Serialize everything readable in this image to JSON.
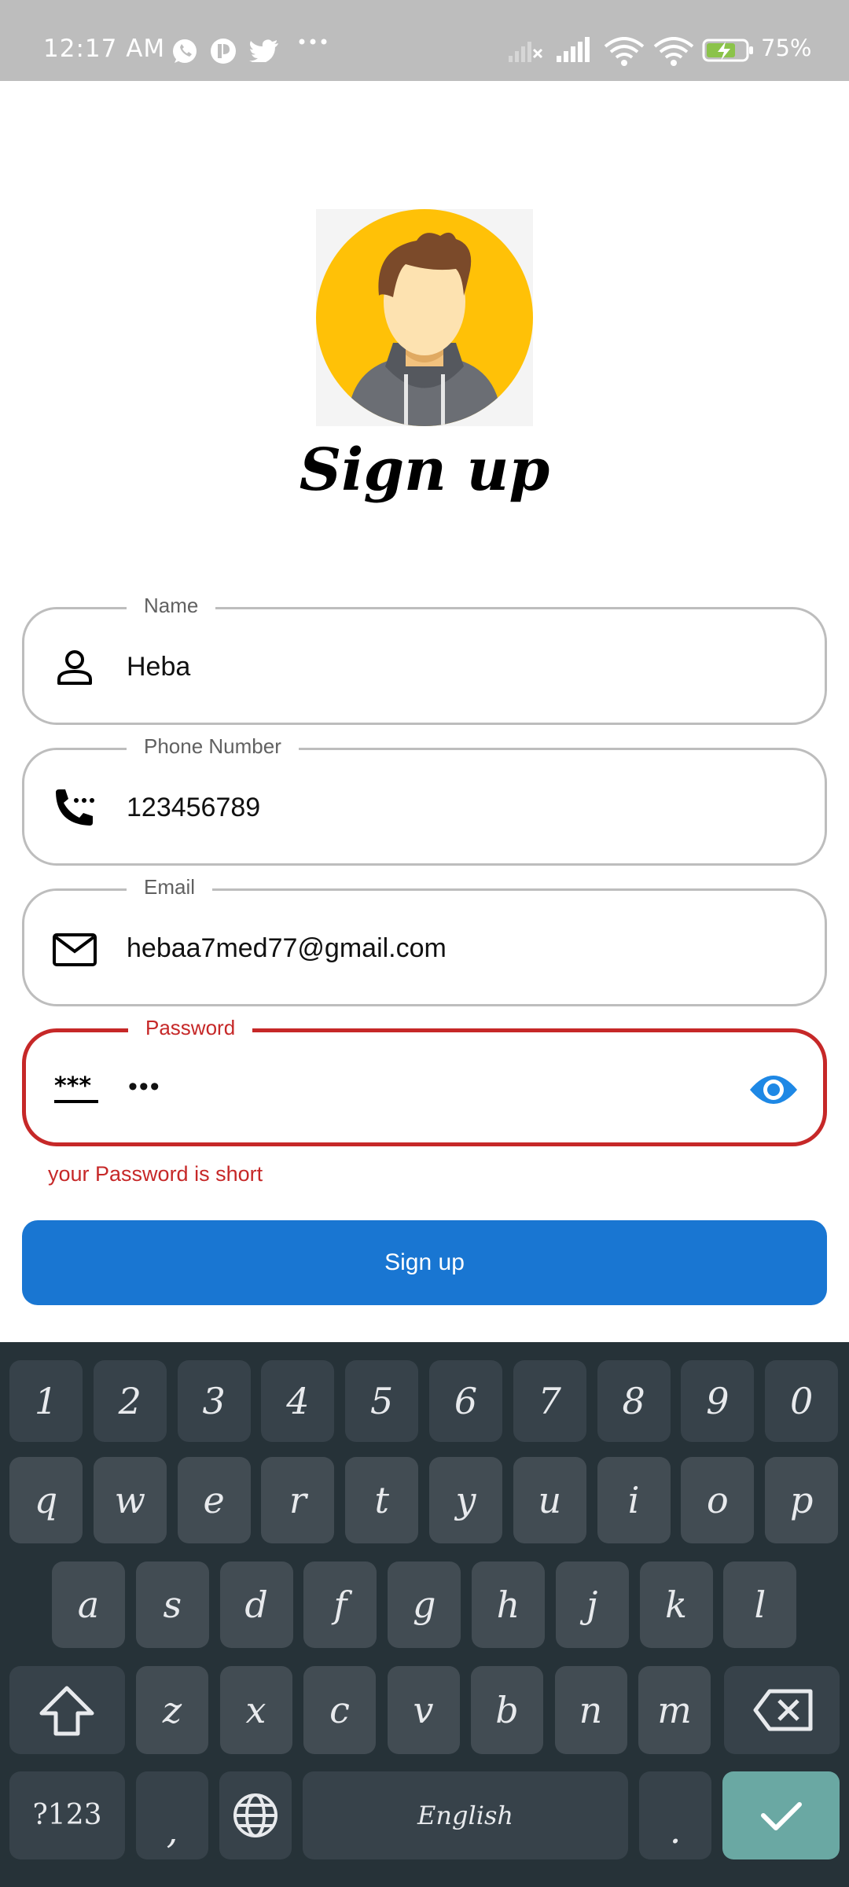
{
  "status_bar": {
    "time": "12:17 AM",
    "battery": "75%",
    "icons": [
      "whatsapp-icon",
      "app-icon",
      "twitter-icon",
      "more-icon",
      "signal-off-icon",
      "signal-icon",
      "wifi-icon",
      "wifi-icon",
      "battery-charging-icon"
    ]
  },
  "header": {
    "title": "Sign up"
  },
  "form": {
    "name": {
      "label": "Name",
      "value": "Heba"
    },
    "phone": {
      "label": "Phone Number",
      "value": "123456789"
    },
    "email": {
      "label": "Email",
      "value": "hebaa7med77@gmail.com"
    },
    "password": {
      "label": "Password",
      "value": "•••",
      "error": "your Password is short"
    },
    "submit_label": "Sign up"
  },
  "keyboard": {
    "row1": [
      "1",
      "2",
      "3",
      "4",
      "5",
      "6",
      "7",
      "8",
      "9",
      "0"
    ],
    "row2": [
      "q",
      "w",
      "e",
      "r",
      "t",
      "y",
      "u",
      "i",
      "o",
      "p"
    ],
    "row3": [
      "a",
      "s",
      "d",
      "f",
      "g",
      "h",
      "j",
      "k",
      "l"
    ],
    "row4": [
      "z",
      "x",
      "c",
      "v",
      "b",
      "n",
      "m"
    ],
    "symbols_label": "?123",
    "comma_label": ",",
    "space_label": "English",
    "period_label": "."
  },
  "colors": {
    "primary": "#1976d2",
    "error": "#c62828",
    "keyboard_bg": "#263238",
    "status_bar_bg": "#bdbdbd"
  }
}
